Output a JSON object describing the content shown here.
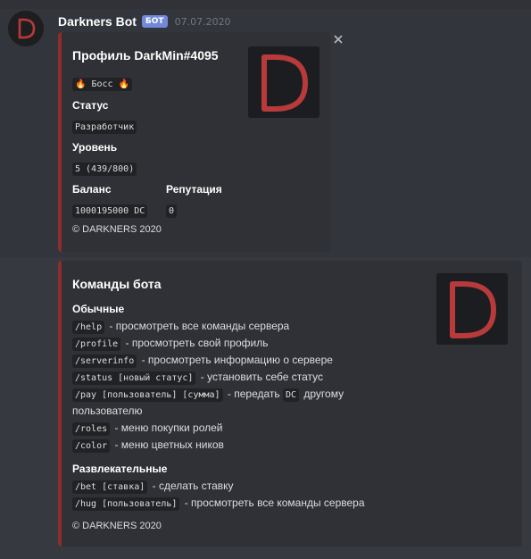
{
  "message": {
    "username": "Darkners Bot",
    "badge": "БОТ",
    "timestamp": "07.07.2020"
  },
  "profile_embed": {
    "title": "Профиль DarkMin#4095",
    "rank_badge": "🔥 Босс 🔥",
    "status_label": "Статус",
    "status_value": "Разработчик",
    "level_label": "Уровень",
    "level_value": "5 (439/800)",
    "balance_label": "Баланс",
    "balance_value": "1000195000 DC",
    "reputation_label": "Репутация",
    "reputation_value": "0",
    "footer": "© DARKNERS 2020"
  },
  "commands_embed": {
    "title": "Команды бота",
    "section_regular": "Обычные",
    "regular": [
      {
        "cmd": "/help",
        "desc": " - просмотреть все команды сервера"
      },
      {
        "cmd": "/profile",
        "desc": " - просмотреть свой профиль"
      },
      {
        "cmd": "/serverinfo",
        "desc": " - просмотреть информацию о сервере"
      },
      {
        "cmd": "/status [новый статус]",
        "desc": " - установить себе статус"
      },
      {
        "cmd": "/pay [пользователь] [сумма]",
        "desc": " - передать ",
        "code2": "DC",
        "desc2": " другому"
      },
      {
        "cmd": "",
        "desc": "пользователю"
      },
      {
        "cmd": "/roles",
        "desc": " - меню покупки ролей"
      },
      {
        "cmd": "/color",
        "desc": " - меню цветных ников"
      }
    ],
    "section_fun": "Развлекательные",
    "fun": [
      {
        "cmd": "/bet [ставка]",
        "desc": " - сделать ставку"
      },
      {
        "cmd": "/hug [пользователь]",
        "desc": " - просмотреть все команды сервера"
      }
    ],
    "footer": "© DARKNERS 2020"
  },
  "icons": {
    "avatar": "darkners-d-logo",
    "thumbnail": "darkners-d-logo",
    "close": "close-icon"
  },
  "colors": {
    "background": "#36393f",
    "embed_bg": "#2f3136",
    "embed_accent": "#8f2c2c",
    "bot_badge": "#7289da",
    "logo_red": "#c0393b"
  }
}
